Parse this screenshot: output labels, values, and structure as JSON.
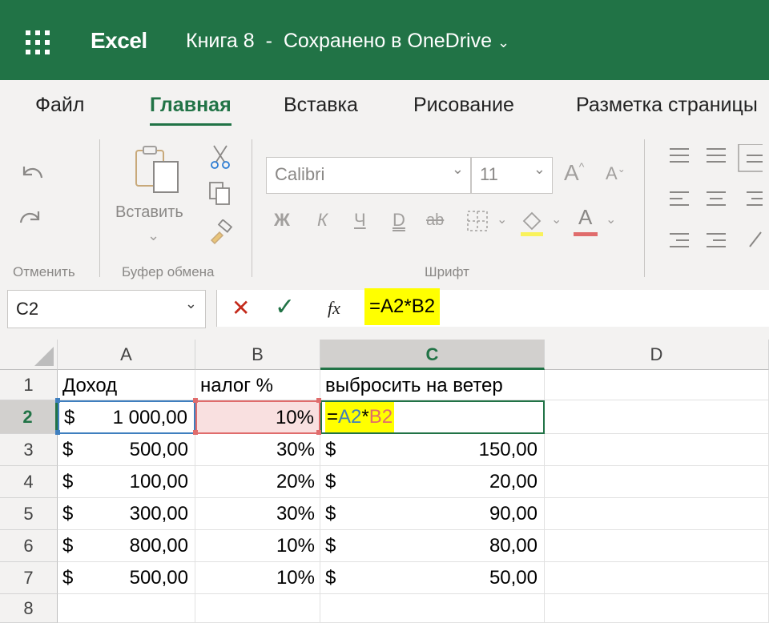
{
  "header": {
    "app_name": "Excel",
    "doc_title": "Книга 8",
    "separator": "-",
    "save_status": "Сохранено в OneDrive",
    "dropdown_glyph": "⌵"
  },
  "tabs": [
    "Файл",
    "Главная",
    "Вставка",
    "Рисование",
    "Разметка страницы"
  ],
  "ribbon": {
    "undo_group_label": "Отменить",
    "clipboard_group_label": "Буфер обмена",
    "paste_label": "Вставить",
    "font_group_label": "Шрифт",
    "font_name": "Calibri",
    "font_size": "11",
    "grow_font": "A",
    "shrink_font": "A",
    "bold": "Ж",
    "italic": "К",
    "underline": "Ч",
    "double_underline": "D",
    "strikethrough": "ab",
    "font_color_letter": "A",
    "highlight_color": "#f9f25b",
    "font_color_bar": "#e06c6c"
  },
  "formula_bar": {
    "name_box": "C2",
    "cancel_glyph": "✕",
    "enter_glyph": "✓",
    "fx_label": "fx",
    "formula": "=A2*B2",
    "highlight": "#ffff00"
  },
  "sheet": {
    "columns": [
      "A",
      "B",
      "C",
      "D"
    ],
    "selected_column": "C",
    "rows": [
      "1",
      "2",
      "3",
      "4",
      "5",
      "6",
      "7",
      "8"
    ],
    "selected_row": "2",
    "headers": {
      "a": "Доход",
      "b": "налог %",
      "c": "выбросить на ветер"
    },
    "currency": "$",
    "data": [
      {
        "row": "2",
        "a": "1 000,00",
        "b": "10%",
        "c_formula": {
          "eq": "=",
          "ref1": "A2",
          "op": "*",
          "ref2": "B2"
        }
      },
      {
        "row": "3",
        "a": "500,00",
        "b": "30%",
        "c": "150,00"
      },
      {
        "row": "4",
        "a": "100,00",
        "b": "20%",
        "c": "20,00"
      },
      {
        "row": "5",
        "a": "300,00",
        "b": "30%",
        "c": "90,00"
      },
      {
        "row": "6",
        "a": "800,00",
        "b": "10%",
        "c": "80,00"
      },
      {
        "row": "7",
        "a": "500,00",
        "b": "10%",
        "c": "50,00"
      }
    ],
    "ref_colors": {
      "a": "#3f7fbf",
      "b": "#e06c6c",
      "c_border": "#217346"
    }
  }
}
